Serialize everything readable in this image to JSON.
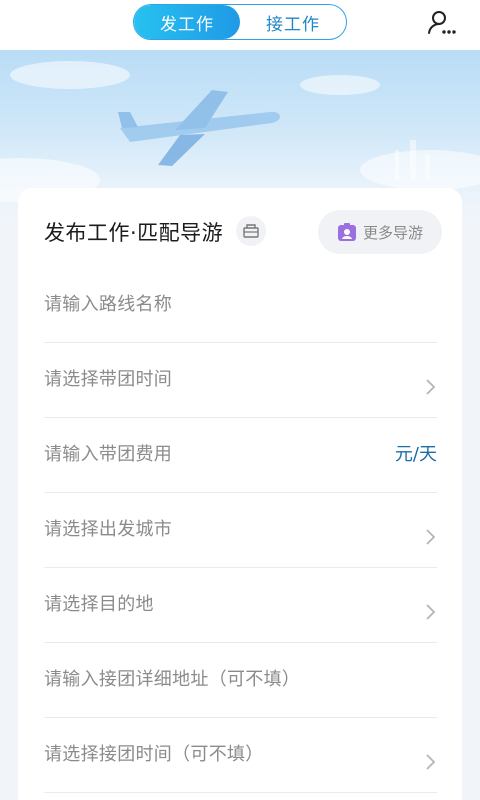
{
  "header": {
    "tabs": [
      {
        "label": "发工作",
        "active": true
      },
      {
        "label": "接工作",
        "active": false
      }
    ],
    "user_icon": "user-more-icon"
  },
  "form": {
    "title": "发布工作·匹配导游",
    "clear_icon": "basket-icon",
    "more_guides_label": "更多导游",
    "more_guides_icon": "guide-badge-icon",
    "fields": [
      {
        "placeholder": "请输入路线名称",
        "type": "input"
      },
      {
        "placeholder": "请选择带团时间",
        "type": "select"
      },
      {
        "placeholder": "请输入带团费用",
        "type": "input",
        "suffix": "元/天"
      },
      {
        "placeholder": "请选择出发城市",
        "type": "select"
      },
      {
        "placeholder": "请选择目的地",
        "type": "select"
      },
      {
        "placeholder": "请输入接团详细地址（可不填）",
        "type": "input"
      },
      {
        "placeholder": "请选择接团时间（可不填）",
        "type": "select"
      }
    ]
  },
  "colors": {
    "accent": "#1f9ae6",
    "accent_light": "#27c1f0",
    "suffix_text": "#1a6ea8",
    "more_icon": "#9b6fe0"
  }
}
